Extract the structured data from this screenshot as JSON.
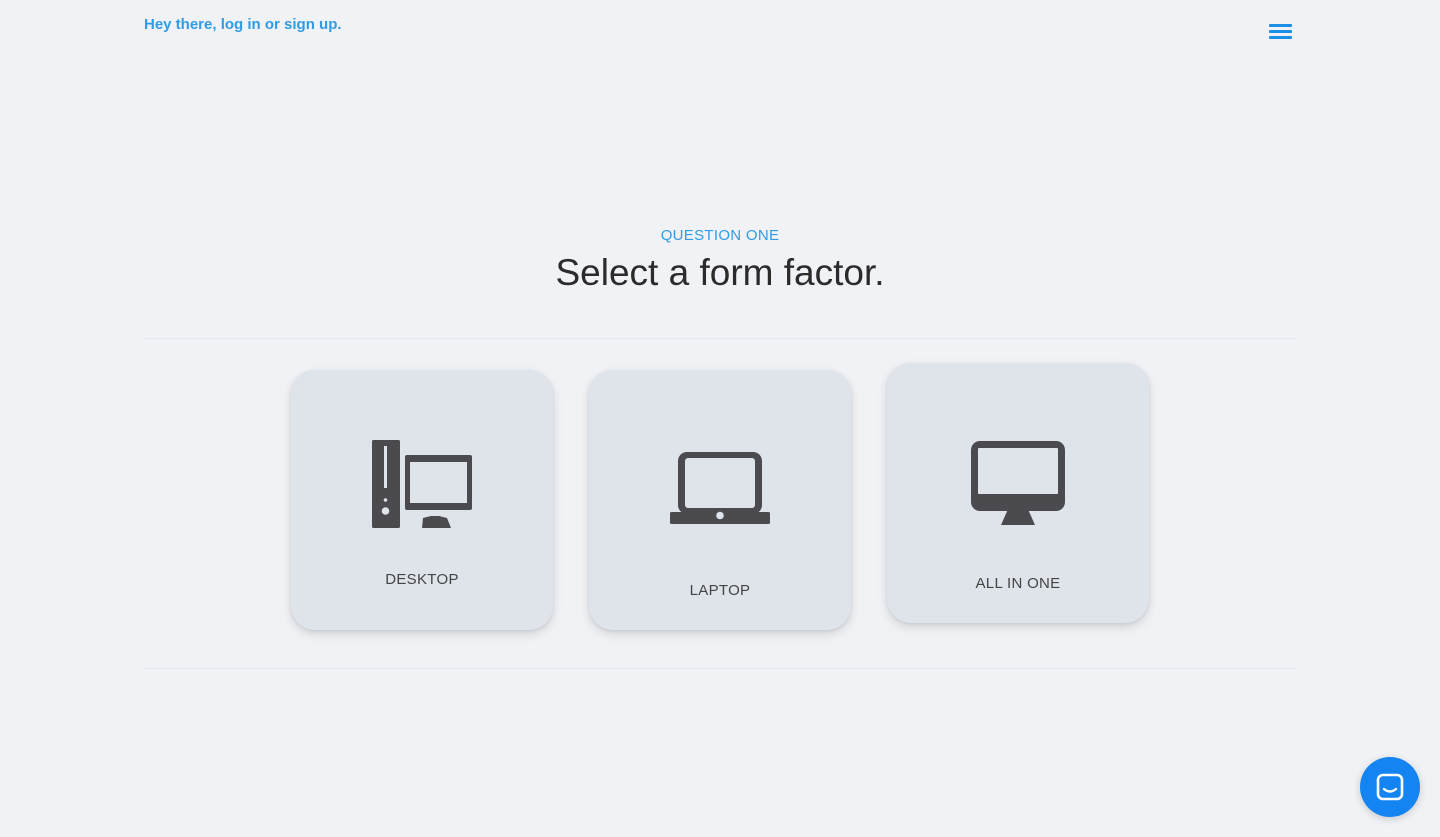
{
  "header": {
    "login_text": "Hey there, log in or sign up.",
    "menu_icon": "hamburger-menu-icon"
  },
  "question": {
    "label": "QUESTION ONE",
    "title": "Select a form factor."
  },
  "options": [
    {
      "label": "DESKTOP",
      "icon": "desktop-tower-monitor-icon"
    },
    {
      "label": "LAPTOP",
      "icon": "laptop-icon"
    },
    {
      "label": "ALL IN ONE",
      "icon": "all-in-one-monitor-icon"
    }
  ],
  "chat": {
    "icon": "chat-bubble-icon"
  },
  "colors": {
    "accent": "#2f9ce8",
    "background": "#f0f2f6",
    "card": "#dfe3ea",
    "icon": "#4a4a4f",
    "chat_button": "#1384f2"
  }
}
